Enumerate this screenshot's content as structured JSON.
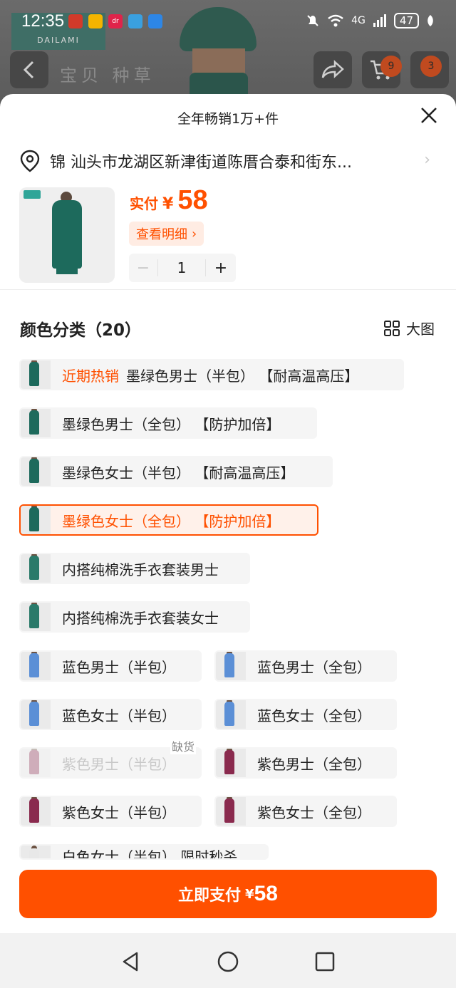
{
  "status_bar": {
    "time": "12:35",
    "signal_label": "4G",
    "battery": "47",
    "app_icons": [
      {
        "name": "app-icon-1",
        "color": "#d23a2a",
        "text": ""
      },
      {
        "name": "app-icon-weibo",
        "color": "#f4b400",
        "text": ""
      },
      {
        "name": "app-icon-3",
        "color": "#e0234a",
        "text": "dr"
      },
      {
        "name": "app-icon-4",
        "color": "#3aa0e0",
        "text": ""
      },
      {
        "name": "app-icon-message",
        "color": "#2d86e6",
        "text": ""
      }
    ]
  },
  "background_page": {
    "logo_text": "DAILAMI",
    "tabs_text": "宝贝 种草",
    "cart_badge": "9",
    "more_badge": "3"
  },
  "sheet": {
    "title": "全年畅销1万+件",
    "address": "锦 汕头市龙湖区新津街道陈厝合泰和街东...",
    "price_label": "实付",
    "currency": "¥",
    "price": "58",
    "detail_button": "查看明细",
    "quantity": "1",
    "section_title": "颜色分类（20）",
    "view_toggle_label": "大图",
    "options": [
      {
        "label": "墨绿色男士（半包）  【耐高温高压】",
        "hot": "近期热销",
        "state": "normal",
        "color": "#1d6a5c"
      },
      {
        "label": "墨绿色男士（全包）  【防护加倍】",
        "state": "normal",
        "color": "#1d6a5c"
      },
      {
        "label": "墨绿色女士（半包）  【耐高温高压】",
        "state": "normal",
        "color": "#1d6a5c"
      },
      {
        "label": "墨绿色女士（全包）  【防护加倍】",
        "state": "selected",
        "color": "#1d6a5c"
      },
      {
        "label": "内搭纯棉洗手衣套装男士",
        "state": "normal",
        "color": "#2a7a6a"
      },
      {
        "label": "内搭纯棉洗手衣套装女士",
        "state": "normal",
        "color": "#2a7a6a"
      },
      {
        "label": "蓝色男士（半包）",
        "state": "normal",
        "color": "#5b8fd6"
      },
      {
        "label": "蓝色男士（全包）",
        "state": "normal",
        "color": "#5b8fd6"
      },
      {
        "label": "蓝色女士（半包）",
        "state": "normal",
        "color": "#5b8fd6"
      },
      {
        "label": "蓝色女士（全包）",
        "state": "normal",
        "color": "#5b8fd6"
      },
      {
        "label": "紫色男士（半包）",
        "state": "disabled",
        "badge": "缺货",
        "color": "#8a2a4e"
      },
      {
        "label": "紫色男士（全包）",
        "state": "normal",
        "color": "#8a2a4e"
      },
      {
        "label": "紫色女士（半包）",
        "state": "normal",
        "color": "#8a2a4e"
      },
      {
        "label": "紫色女士（全包）",
        "state": "normal",
        "color": "#8a2a4e"
      },
      {
        "label": "白色女士（半包）  限时秒杀",
        "state": "normal",
        "color": "#e8e8e8"
      }
    ],
    "pay_button": {
      "label": "立即支付",
      "currency": "¥",
      "amount": "58"
    }
  },
  "colors": {
    "accent": "#ff5000"
  }
}
